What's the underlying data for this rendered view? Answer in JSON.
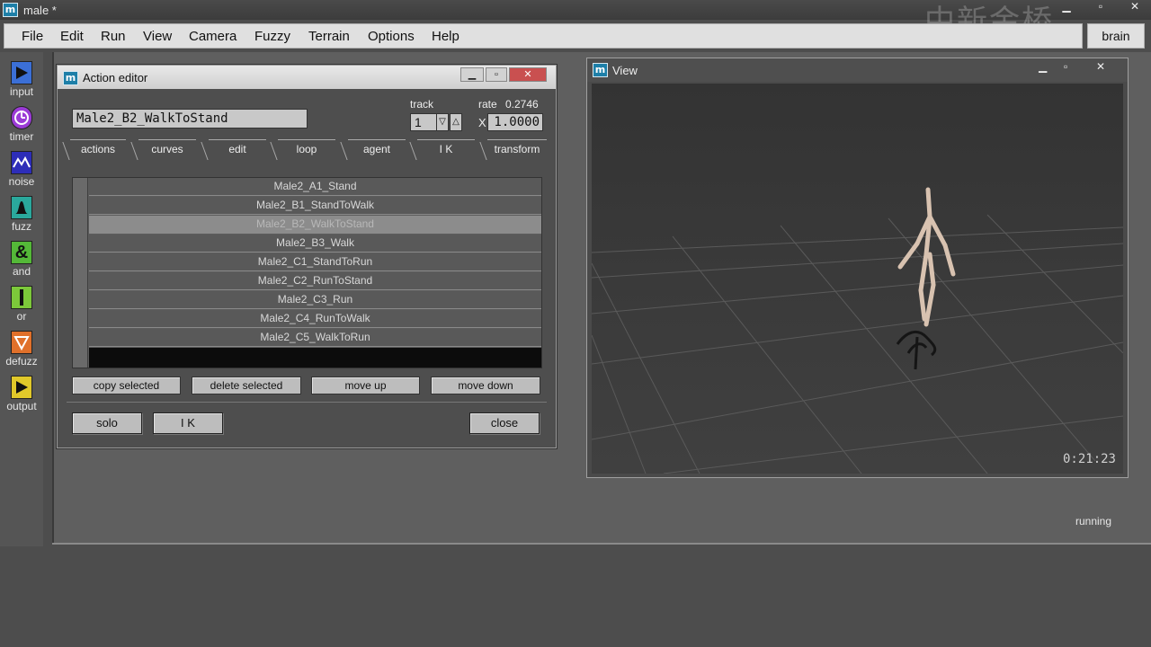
{
  "app": {
    "title": "male *",
    "watermark": "中新金桥",
    "brain_label": "brain",
    "status": "running"
  },
  "menu": [
    "File",
    "Edit",
    "Run",
    "View",
    "Camera",
    "Fuzzy",
    "Terrain",
    "Options",
    "Help"
  ],
  "palette": [
    {
      "label": "input",
      "icon": "play-icon",
      "color": "#3b6fd6"
    },
    {
      "label": "timer",
      "icon": "clock-icon",
      "color": "#9b3bd6"
    },
    {
      "label": "noise",
      "icon": "wave-icon",
      "color": "#2d2db8"
    },
    {
      "label": "fuzz",
      "icon": "bell-icon",
      "color": "#2aa89c"
    },
    {
      "label": "and",
      "icon": "ampersand-icon",
      "color": "#54b838"
    },
    {
      "label": "or",
      "icon": "bar-icon",
      "color": "#7cc83a"
    },
    {
      "label": "defuzz",
      "icon": "triangle-down-icon",
      "color": "#e0702a"
    },
    {
      "label": "output",
      "icon": "play-icon",
      "color": "#e0c82a"
    }
  ],
  "editor": {
    "title": "Action editor",
    "action_name": "Male2_B2_WalkToStand",
    "track_label": "track",
    "track_value": "1",
    "rate_label": "rate",
    "rate_value": "0.2746",
    "x_label": "X",
    "rate_input": "1.0000",
    "tabs": [
      "actions",
      "curves",
      "edit",
      "loop",
      "agent",
      "I K",
      "transform"
    ],
    "actions": [
      "Male2_A1_Stand",
      "Male2_B1_StandToWalk",
      "Male2_B2_WalkToStand",
      "Male2_B3_Walk",
      "Male2_C1_StandToRun",
      "Male2_C2_RunToStand",
      "Male2_C3_Run",
      "Male2_C4_RunToWalk",
      "Male2_C5_WalkToRun"
    ],
    "selected_index": 2,
    "buttons": [
      "copy selected",
      "delete selected",
      "move up",
      "move down"
    ],
    "bottom_buttons": {
      "solo": "solo",
      "ik": "I K",
      "close": "close"
    }
  },
  "view": {
    "title": "View",
    "timecode": "0:21:23"
  }
}
